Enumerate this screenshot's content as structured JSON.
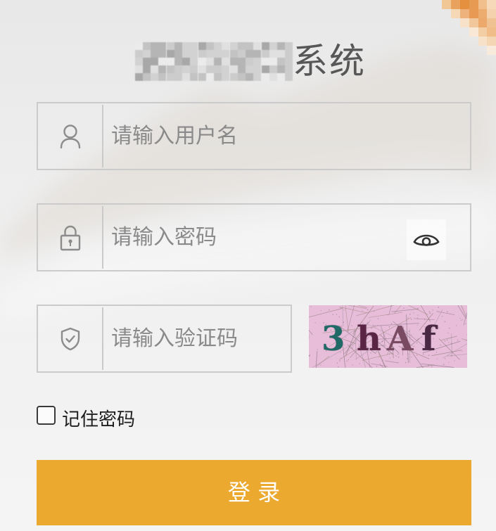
{
  "title": {
    "text": "系统"
  },
  "form": {
    "username": {
      "placeholder": "请输入用户名",
      "value": "",
      "icon": "user-icon"
    },
    "password": {
      "placeholder": "请输入密码",
      "value": "",
      "icon": "lock-icon",
      "toggle_icon": "eye-icon"
    },
    "captcha": {
      "placeholder": "请输入验证码",
      "value": "",
      "icon": "shield-check-icon",
      "image_text": [
        "3",
        "h",
        "A",
        "f"
      ],
      "image_colors": [
        "#1f6a66",
        "#5a2545",
        "#7a4a62",
        "#4a2743"
      ],
      "image_background": "#e7bdda"
    },
    "remember": {
      "label": "记住密码",
      "checked": false
    },
    "submit": {
      "label": "登 录"
    }
  },
  "colors": {
    "accent": "#eca92f",
    "border": "#cbcbcb",
    "placeholder": "#8a8a8a",
    "icon": "#8c8c8c",
    "title": "#575757"
  }
}
